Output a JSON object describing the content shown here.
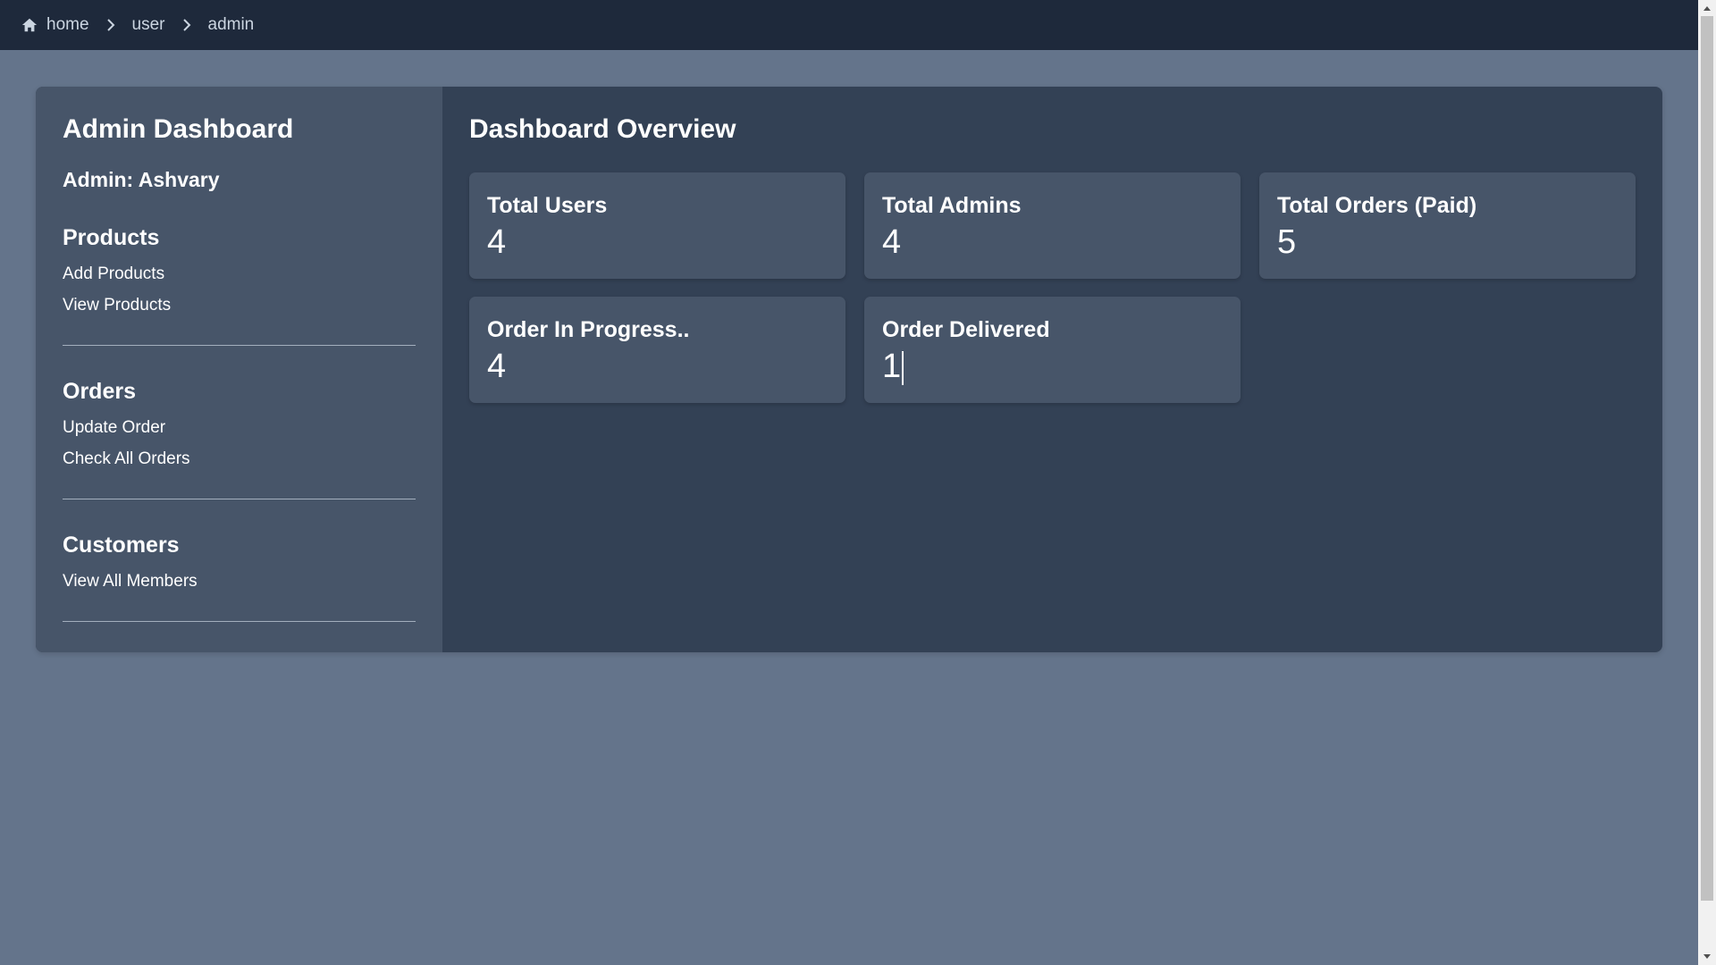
{
  "breadcrumb": {
    "items": [
      "home",
      "user",
      "admin"
    ],
    "icon": "home-icon"
  },
  "sidebar": {
    "title": "Admin Dashboard",
    "admin_label": "Admin: Ashvary",
    "sections": [
      {
        "title": "Products",
        "links": [
          "Add Products",
          "View Products"
        ]
      },
      {
        "title": "Orders",
        "links": [
          "Update Order",
          "Check All Orders"
        ]
      },
      {
        "title": "Customers",
        "links": [
          "View All Members"
        ]
      }
    ]
  },
  "main": {
    "title": "Dashboard Overview",
    "cards": [
      {
        "label": "Total Users",
        "value": "4"
      },
      {
        "label": "Total Admins",
        "value": "4"
      },
      {
        "label": "Total Orders (Paid)",
        "value": "5"
      },
      {
        "label": "Order In Progress..",
        "value": "4"
      },
      {
        "label": "Order Delivered",
        "value": "1"
      }
    ]
  },
  "colors": {
    "page_bg": "#64748b",
    "topbar_bg": "#1e293b",
    "sidebar_bg": "#475569",
    "main_bg": "#334155",
    "card_bg": "#475569"
  }
}
